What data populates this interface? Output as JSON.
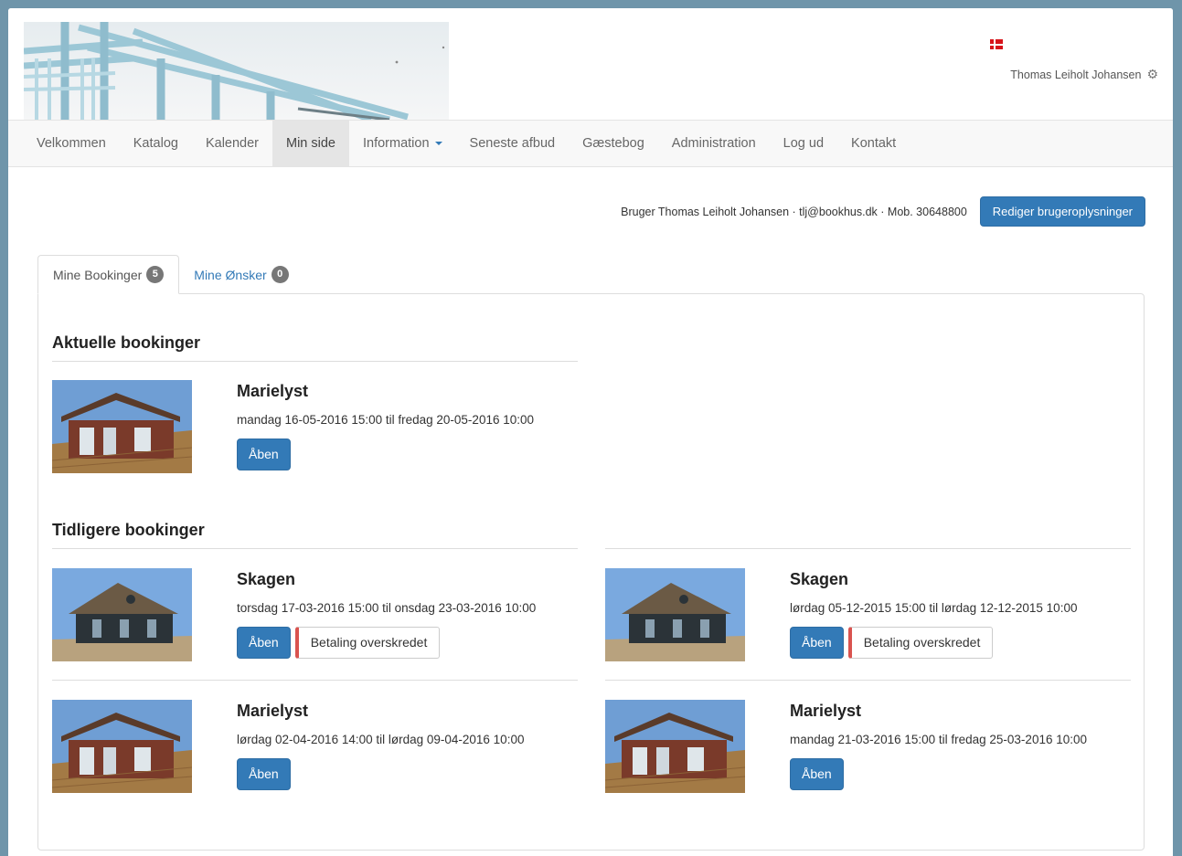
{
  "header": {
    "user_name": "Thomas Leiholt Johansen",
    "flag_icon": "danish-flag-icon",
    "settings_icon": "gear-icon"
  },
  "nav": {
    "items": [
      {
        "label": "Velkommen"
      },
      {
        "label": "Katalog"
      },
      {
        "label": "Kalender"
      },
      {
        "label": "Min side",
        "active": true
      },
      {
        "label": "Information",
        "dropdown": true
      },
      {
        "label": "Seneste afbud"
      },
      {
        "label": "Gæstebog"
      },
      {
        "label": "Administration"
      },
      {
        "label": "Log ud"
      },
      {
        "label": "Kontakt"
      }
    ]
  },
  "userinfo": {
    "text": "Bruger Thomas Leiholt Johansen · tlj@bookhus.dk · Mob. 30648800",
    "edit_button": "Rediger brugeroplysninger"
  },
  "tabs": [
    {
      "label": "Mine Bookinger",
      "count": "5",
      "active": true
    },
    {
      "label": "Mine Ønsker",
      "count": "0",
      "active": false
    }
  ],
  "current": {
    "title": "Aktuelle bookinger",
    "bookings": [
      {
        "name": "Marielyst",
        "dates": "mandag 16-05-2016 15:00 til fredag 20-05-2016 10:00",
        "open_label": "Åben"
      }
    ]
  },
  "previous": {
    "title": "Tidligere bookinger",
    "bookings": [
      {
        "name": "Skagen",
        "dates": "torsdag 17-03-2016 15:00 til onsdag 23-03-2016 10:00",
        "open_label": "Åben",
        "alert_label": "Betaling overskredet"
      },
      {
        "name": "Skagen",
        "dates": "lørdag 05-12-2015 15:00 til lørdag 12-12-2015 10:00",
        "open_label": "Åben",
        "alert_label": "Betaling overskredet"
      },
      {
        "name": "Marielyst",
        "dates": "lørdag 02-04-2016 14:00 til lørdag 09-04-2016 10:00",
        "open_label": "Åben"
      },
      {
        "name": "Marielyst",
        "dates": "mandag 21-03-2016 15:00 til fredag 25-03-2016 10:00",
        "open_label": "Åben"
      }
    ]
  },
  "colors": {
    "primary": "#337ab7",
    "alert_accent": "#d9534f",
    "badge": "#777777",
    "outer_background": "#6f95aa"
  }
}
